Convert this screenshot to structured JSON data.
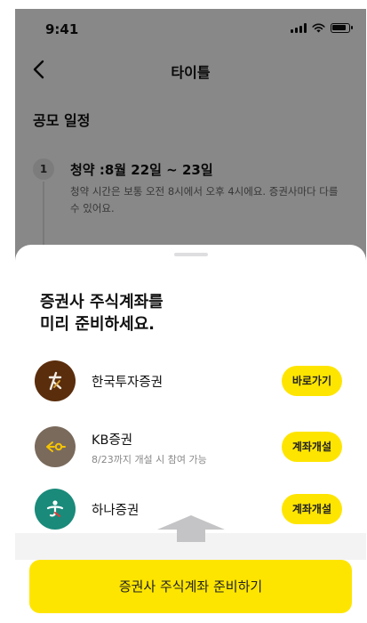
{
  "status_bar": {
    "time": "9:41"
  },
  "nav": {
    "title": "타이틀"
  },
  "schedule": {
    "section_title": "공모 일정",
    "steps": [
      {
        "number": "1",
        "title": "청약 :8월 22일 ~ 23일",
        "description": "청약 시간은 보통 오전 8시에서 오후 4시에요. 증권사마다 다를 수 있어요."
      }
    ]
  },
  "sheet": {
    "title_line1": "증권사 주식계좌를",
    "title_line2": "미리 준비하세요.",
    "brokers": [
      {
        "name": "한국투자증권",
        "subtitle": "",
        "button": "바로가기",
        "logo_color": "#5a2d0c",
        "icon": "korea-investment-logo-icon"
      },
      {
        "name": "KB증권",
        "subtitle": "8/23까지 개설 시 참여 가능",
        "button": "계좌개설",
        "logo_color": "#7a6a5c",
        "icon": "kb-logo-icon"
      },
      {
        "name": "하나증권",
        "subtitle": "",
        "button": "계좌개설",
        "logo_color": "#1a8a7a",
        "icon": "hana-logo-icon"
      }
    ],
    "cta": "증권사 주식계좌 준비하기"
  },
  "colors": {
    "accent": "#fee500"
  }
}
